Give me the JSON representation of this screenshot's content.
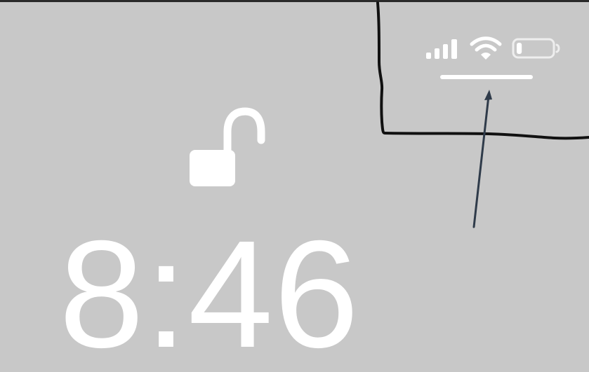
{
  "lock_screen": {
    "time": "8:46",
    "lock_state": "unlocked"
  },
  "status_bar": {
    "icons": [
      "cellular-signal-icon",
      "wifi-icon",
      "battery-icon"
    ],
    "battery_level": 0.15
  },
  "colors": {
    "background": "#c8c8c8",
    "foreground": "#ffffff",
    "annotation_box": "#111111",
    "annotation_arrow": "#2f3b4a"
  }
}
